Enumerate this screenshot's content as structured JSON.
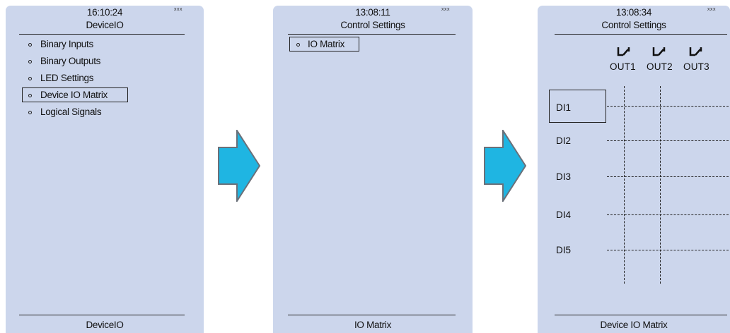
{
  "screens": [
    {
      "time": "16:10:24",
      "status": "xxx",
      "title": "DeviceIO",
      "footer": "DeviceIO",
      "items": [
        "Binary Inputs",
        "Binary Outputs",
        "LED Settings",
        "Device IO Matrix",
        "Logical Signals"
      ],
      "selected": "Device IO Matrix"
    },
    {
      "time": "13:08:11",
      "status": "xxx",
      "title": "Control Settings",
      "footer": "IO Matrix",
      "items": [
        "IO Matrix"
      ],
      "selected": "IO Matrix"
    },
    {
      "time": "13:08:34",
      "status": "xxx",
      "title": "Control Settings",
      "footer": "Device IO Matrix",
      "outputs": [
        "OUT1",
        "OUT2",
        "OUT3"
      ],
      "inputs": [
        "DI1",
        "DI2",
        "DI3",
        "DI4",
        "DI5"
      ],
      "selected": "DI1",
      "output_icon": "relay-contact-icon"
    }
  ],
  "transition_icon": "right-arrow-icon",
  "colors": {
    "screen_bg": "#ccd6ec",
    "arrow_fill": "#1fb5e2",
    "arrow_stroke": "#6a7079",
    "line": "#222222"
  }
}
